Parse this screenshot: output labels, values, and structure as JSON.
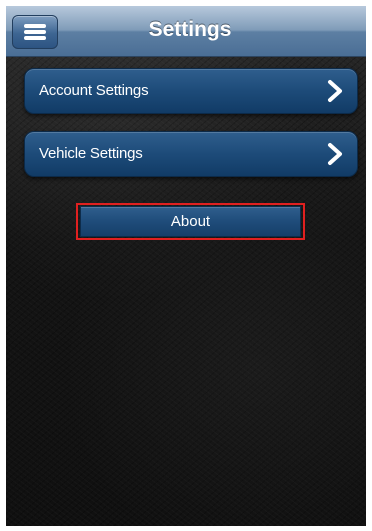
{
  "header": {
    "title": "Settings",
    "menu_icon": "hamburger-menu-icon"
  },
  "menu": {
    "items": [
      {
        "label": "Account Settings",
        "icon": "chevron-right-icon"
      },
      {
        "label": "Vehicle Settings",
        "icon": "chevron-right-icon"
      }
    ],
    "about_label": "About"
  },
  "colors": {
    "header_top": "#b7c9dc",
    "header_bottom": "#4a6e95",
    "button_blue": "#1d4b79",
    "highlight_red": "#e02020",
    "background": "#141414"
  }
}
